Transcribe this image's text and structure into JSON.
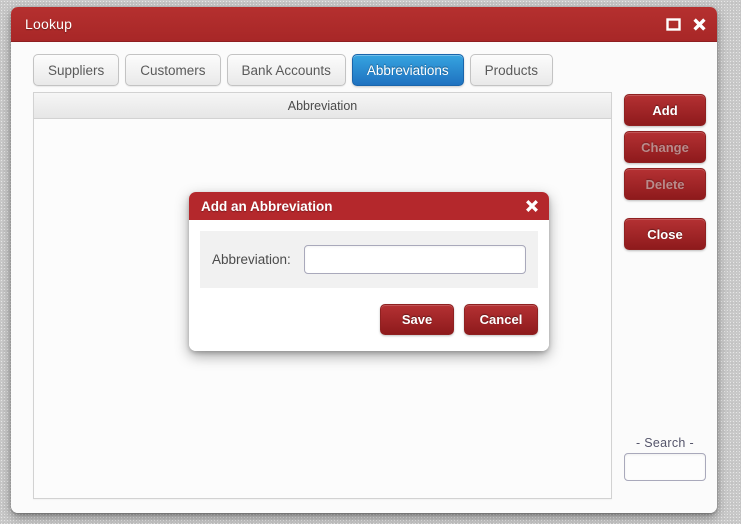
{
  "window": {
    "title": "Lookup",
    "controls": [
      {
        "name": "maximize-button",
        "icon": "square-icon"
      },
      {
        "name": "close-button",
        "icon": "close-x-icon"
      }
    ]
  },
  "tabs": [
    {
      "label": "Suppliers",
      "active": false
    },
    {
      "label": "Customers",
      "active": false
    },
    {
      "label": "Bank Accounts",
      "active": false
    },
    {
      "label": "Abbreviations",
      "active": true
    },
    {
      "label": "Products",
      "active": false
    }
  ],
  "table": {
    "columns": [
      "Abbreviation"
    ],
    "rows": []
  },
  "actions": {
    "add_label": "Add",
    "change_label": "Change",
    "delete_label": "Delete",
    "close_label": "Close"
  },
  "search": {
    "label": "- Search -",
    "value": "",
    "placeholder": ""
  },
  "modal": {
    "title": "Add an Abbreviation",
    "close_icon": "close-x-icon",
    "field_label": "Abbreviation:",
    "field_value": "",
    "field_placeholder": "",
    "save_label": "Save",
    "cancel_label": "Cancel"
  },
  "colors": {
    "title_red": "#b4282c",
    "button_red": "#a82727",
    "active_tab_blue": "#2287cf",
    "disabled_text": "#b98b8b",
    "window_bg": "#fbfbfb",
    "desktop_bg": "#c9c9c9"
  }
}
